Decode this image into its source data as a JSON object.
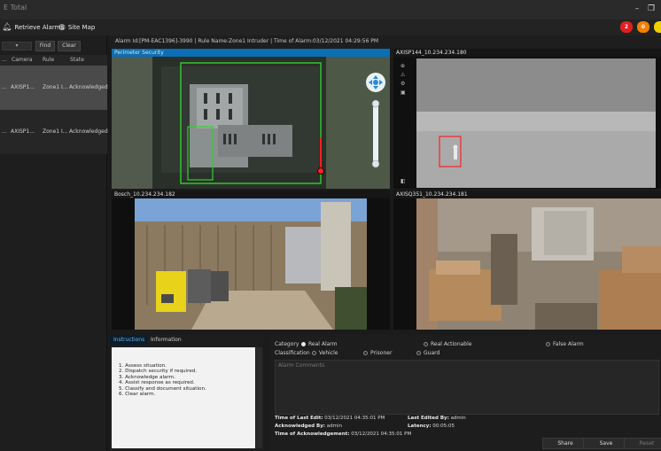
{
  "window": {
    "title": "E Total",
    "minimize_glyph": "–",
    "restore_glyph": "❐"
  },
  "toolbar": {
    "retrieve_alarms": "Retrieve Alarms",
    "retrieve_icon": "bell-icon",
    "site_map": "Site Map",
    "site_map_icon": "globe-icon",
    "badges": [
      {
        "value": "2",
        "color": "#e02020",
        "text_color": "#ffffff"
      },
      {
        "value": "0",
        "color": "#f08000",
        "text_color": "#ffffff"
      },
      {
        "value": "",
        "color": "#f0d000",
        "text_color": "#ffffff"
      }
    ]
  },
  "left_panel": {
    "find_label": "Find",
    "clear_label": "Clear",
    "columns": {
      "camera": "Camera",
      "rule": "Rule",
      "state": "State"
    },
    "rows": [
      {
        "dots": "...",
        "camera": "AXISP1...",
        "rule": "Zone1 I...",
        "state": "Acknowledged",
        "selected": true
      },
      {
        "dots": "...",
        "camera": "AXISP1...",
        "rule": "Zone1 I...",
        "state": "Acknowledged",
        "selected": false
      }
    ]
  },
  "alarm_header": "Alarm Id:[PM-EAC1396]-3990 | Rule Name:Zone1 Intruder | Time of Alarm:03/12/2021 04:29:56 PM",
  "cameras": [
    {
      "label": "Perimeter Security"
    },
    {
      "label": "AXISP144_10.234.234.180"
    },
    {
      "label": "Bosch_10.234.234.182"
    },
    {
      "label": "AXISQ351_10.234.234.181"
    }
  ],
  "tabs": {
    "instructions": "Instructions",
    "information": "Information"
  },
  "instructions": [
    "1. Assess situation.",
    "2. Dispatch security if required.",
    "3. Acknowledge alarm.",
    "4. Assist response as required.",
    "5. Classify and document situation.",
    "6. Clear alarm."
  ],
  "form": {
    "category_label": "Category",
    "categories": [
      {
        "label": "Real Alarm",
        "selected": true
      },
      {
        "label": "Real Actionable",
        "selected": false
      },
      {
        "label": "False Alarm",
        "selected": false
      }
    ],
    "classification_label": "Classification",
    "classifications": [
      {
        "label": "Vehicle",
        "selected": false
      },
      {
        "label": "Prisoner",
        "selected": false
      },
      {
        "label": "Guard",
        "selected": false
      }
    ],
    "comment_placeholder": "Alarm Comments",
    "last_edit_label": "Time of Last Edit:",
    "last_edit_value": "03/12/2021 04:35:01 PM",
    "last_edited_by_label": "Last Edited By:",
    "last_edited_by_value": "admin",
    "ack_by_label": "Acknowledged By:",
    "ack_by_value": "admin",
    "latency_label": "Latency:",
    "latency_value": "00:05:05",
    "ack_time_label": "Time of Acknowledgement:",
    "ack_time_value": "03/12/2021 04:35:01 PM",
    "share_label": "Share",
    "save_label": "Save",
    "reset_label": "Reset"
  }
}
